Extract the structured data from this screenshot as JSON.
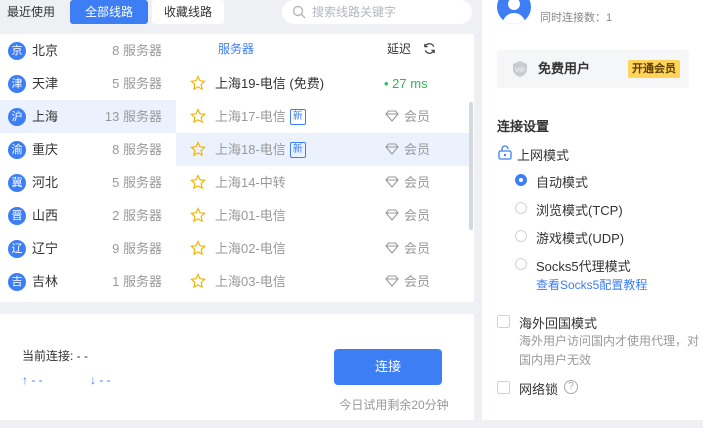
{
  "tabs": {
    "recent": "最近使用",
    "all": "全部线路",
    "favorites": "收藏线路"
  },
  "search": {
    "placeholder": "搜索线路关键字"
  },
  "header": {
    "servers": "服务器",
    "latency": "延迟"
  },
  "provinces": [
    {
      "badge": "京",
      "name": "北京",
      "count": "8 服务器"
    },
    {
      "badge": "津",
      "name": "天津",
      "count": "5 服务器"
    },
    {
      "badge": "沪",
      "name": "上海",
      "count": "13 服务器"
    },
    {
      "badge": "渝",
      "name": "重庆",
      "count": "8 服务器"
    },
    {
      "badge": "冀",
      "name": "河北",
      "count": "5 服务器"
    },
    {
      "badge": "晋",
      "name": "山西",
      "count": "2 服务器"
    },
    {
      "badge": "辽",
      "name": "辽宁",
      "count": "9 服务器"
    },
    {
      "badge": "吉",
      "name": "吉林",
      "count": "1 服务器"
    }
  ],
  "servers": [
    {
      "name": "上海19-电信 (免费)",
      "latency": "• 27 ms"
    },
    {
      "name": "上海17-电信",
      "tag": "新",
      "member": "会员"
    },
    {
      "name": "上海18-电信",
      "tag": "新",
      "member": "会员"
    },
    {
      "name": "上海14-中转",
      "member": "会员"
    },
    {
      "name": "上海01-电信",
      "member": "会员"
    },
    {
      "name": "上海02-电信",
      "member": "会员"
    },
    {
      "name": "上海03-电信",
      "member": "会员"
    }
  ],
  "status": {
    "current": "当前连接: - -",
    "up": "↑ - -",
    "down": "↓ - -"
  },
  "connect": {
    "label": "连接",
    "trial": "今日试用剩余20分钟"
  },
  "account": {
    "simul": "同时连接数：1",
    "tier": "免费用户",
    "upgrade": "开通会员"
  },
  "settings": {
    "title": "连接设置",
    "netmode": "上网模式",
    "modes": [
      "自动模式",
      "浏览模式(TCP)",
      "游戏模式(UDP)",
      "Socks5代理模式"
    ],
    "socks_link": "查看Socks5配置教程",
    "overseas": "海外回国模式",
    "overseas_desc": "海外用户访问国内才使用代理，对国内用户无效",
    "netlock": "网络锁"
  },
  "colors": {
    "accent": "#3d7ef5",
    "latency_good": "#2fb85b",
    "vip_badge": "#ffd458"
  }
}
